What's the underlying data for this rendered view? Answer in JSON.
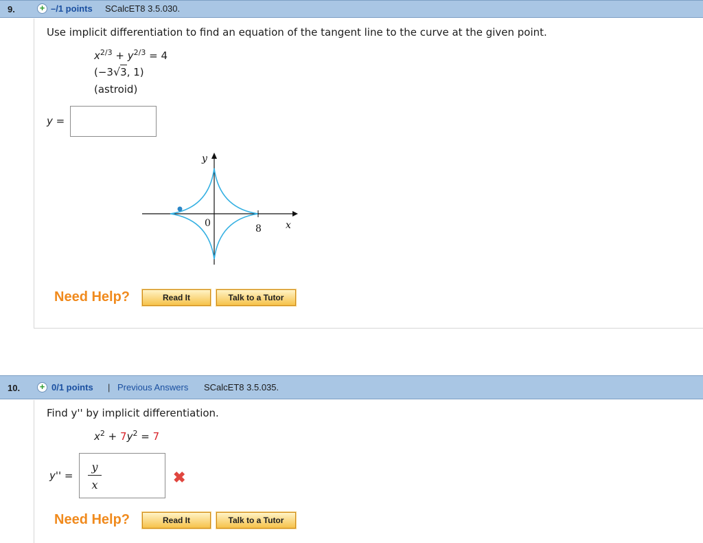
{
  "questions": [
    {
      "number": "9.",
      "points": "–/1 points",
      "code": "SCalcET8 3.5.030.",
      "prompt": "Use implicit differentiation to find an equation of the tangent line to the curve at the given point.",
      "equation": {
        "x": "x",
        "exp1": "2/3",
        "plus": "+",
        "y": "y",
        "exp2": "2/3",
        "eq": "= 4"
      },
      "point": {
        "open": "(−3",
        "radical": "3",
        "close": ", 1)"
      },
      "curve_name": "(astroid)",
      "answer_label": "y =",
      "answer_value": "",
      "graph": {
        "y_label": "y",
        "x_label": "x",
        "origin_label": "0",
        "tick_label": "8",
        "curve_color": "#35b0e2"
      },
      "need_help": "Need Help?",
      "read_it": "Read It",
      "talk_tutor": "Talk to a Tutor"
    },
    {
      "number": "10.",
      "points": "0/1 points",
      "separator": "|",
      "previous_answers": "Previous Answers",
      "code": "SCalcET8 3.5.035.",
      "prompt": "Find y'' by implicit differentiation.",
      "equation": {
        "x": "x",
        "exp1": "2",
        "plus": "+",
        "coef": "7",
        "y": "y",
        "exp2": "2",
        "eq": "=",
        "rhs": "7"
      },
      "answer_label": "y'' =",
      "answer_numerator": "y",
      "answer_denominator": "x",
      "status_icon": "wrong-x-icon",
      "need_help": "Need Help?",
      "read_it": "Read It",
      "talk_tutor": "Talk to a Tutor"
    }
  ],
  "colors": {
    "header_bar": "#a9c6e4",
    "points_link": "#1a4fa0",
    "need_help": "#f08a1d",
    "wrong": "#e0463f",
    "highlight": "#d8232a"
  }
}
